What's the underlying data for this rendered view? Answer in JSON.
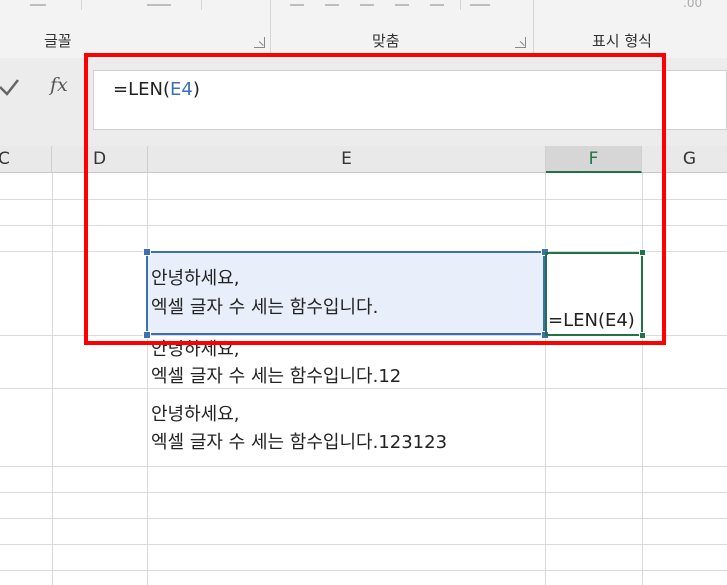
{
  "ribbon": {
    "groups": [
      {
        "label": "글꼴"
      },
      {
        "label": "맞춤"
      },
      {
        "label": "표시 형식"
      }
    ],
    "partial_icon_text": ".00"
  },
  "formula_bar": {
    "formula_prefix": "=LEN(",
    "formula_ref": "E4",
    "formula_suffix": ")"
  },
  "columns": [
    "C",
    "D",
    "E",
    "F",
    "G"
  ],
  "cells": {
    "e4_line1": "안녕하세요,",
    "e4_line2": "엑셀 글자 수 세는 함수입니다.",
    "f4_value": "=LEN(E4)",
    "e5_line1": "안녕하세요,",
    "e5_line2": "엑셀 글자 수 세는 함수입니다.12",
    "e6_line1": "안녕하세요,",
    "e6_line2": "엑셀 글자 수 세는 함수입니다.123123"
  },
  "colors": {
    "highlight": "#ff0000",
    "selection_blue": "#3b6fb6",
    "active_green": "#217346",
    "reference_blue": "#3a6fbf"
  }
}
